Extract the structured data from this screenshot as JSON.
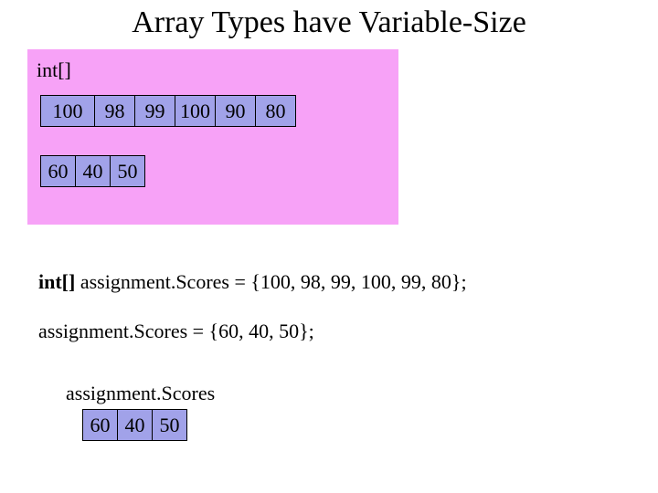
{
  "title": "Array Types have Variable-Size",
  "pink": {
    "type_label": "int[]",
    "row1": [
      "100",
      "98",
      "99",
      "100",
      "90",
      "80"
    ],
    "row2": [
      "60",
      "40",
      "50"
    ]
  },
  "code": {
    "line1_kw": "int[]",
    "line1_rest": " assignment.Scores = {100, 98, 99, 100, 99, 80};",
    "line2": "assignment.Scores = {60, 40, 50};"
  },
  "white": {
    "label": "assignment.Scores",
    "row": [
      "60",
      "40",
      "50"
    ]
  }
}
